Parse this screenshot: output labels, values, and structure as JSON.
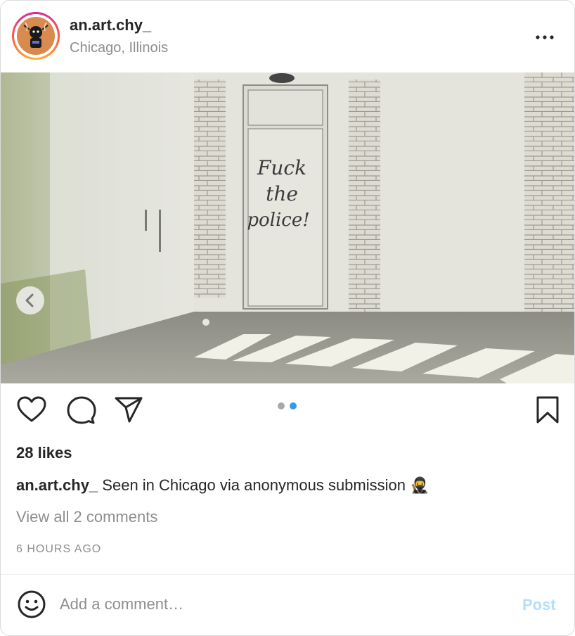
{
  "post": {
    "username": "an.art.chy_",
    "location": "Chicago, Illinois",
    "likes": "28 likes",
    "caption_user": "an.art.chy_",
    "caption_text": "Seen in Chicago via anonymous submission 🥷",
    "view_comments": "View all 2 comments",
    "timestamp": "6 HOURS AGO",
    "image_text": [
      "Fuck",
      "the",
      "police!"
    ]
  },
  "carousel": {
    "current": 2,
    "total": 2,
    "active_color": "#3897f0",
    "inactive_color": "#a8a8a8"
  },
  "comment_bar": {
    "placeholder": "Add a comment…",
    "post_label": "Post"
  },
  "colors": {
    "text": "#262626",
    "secondary": "#8e8e8e",
    "post_disabled": "#b2dffc",
    "border": "#dbdbdb"
  },
  "icons": {
    "avatar": "avatar",
    "more": "more-options-icon",
    "prev": "chevron-left-icon",
    "like": "heart-icon",
    "comment": "comment-icon",
    "share": "send-icon",
    "save": "bookmark-icon",
    "emoji": "emoji-icon"
  }
}
